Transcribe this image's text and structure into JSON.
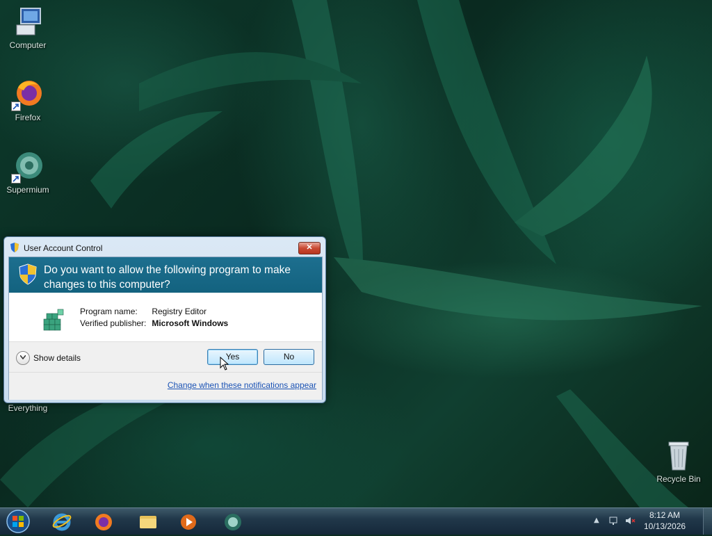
{
  "desktop": {
    "icons": [
      {
        "label": "Computer"
      },
      {
        "label": "Firefox"
      },
      {
        "label": "Supermium"
      },
      {
        "label": "Everything"
      },
      {
        "label": "Recycle Bin"
      }
    ]
  },
  "uac": {
    "title": "User Account Control",
    "close_symbol": "✕",
    "question": "Do you want to allow the following program to make changes to this computer?",
    "program_label": "Program name:",
    "program_value": "Registry Editor",
    "publisher_label": "Verified publisher:",
    "publisher_value": "Microsoft Windows",
    "show_details": "Show details",
    "yes": "Yes",
    "no": "No",
    "change_link": "Change when these notifications appear"
  },
  "taskbar": {
    "items": [
      "start-orb",
      "internet-explorer-icon",
      "firefox-icon",
      "file-explorer-icon",
      "media-player-icon",
      "supermium-icon"
    ],
    "tray_arrow": "▲",
    "clock_time": "8:12 AM",
    "clock_date": "10/13/2026"
  },
  "colors": {
    "uac_banner": "#1d6f8f",
    "button_focus": "#3c7fb1",
    "link": "#1a52b4"
  }
}
